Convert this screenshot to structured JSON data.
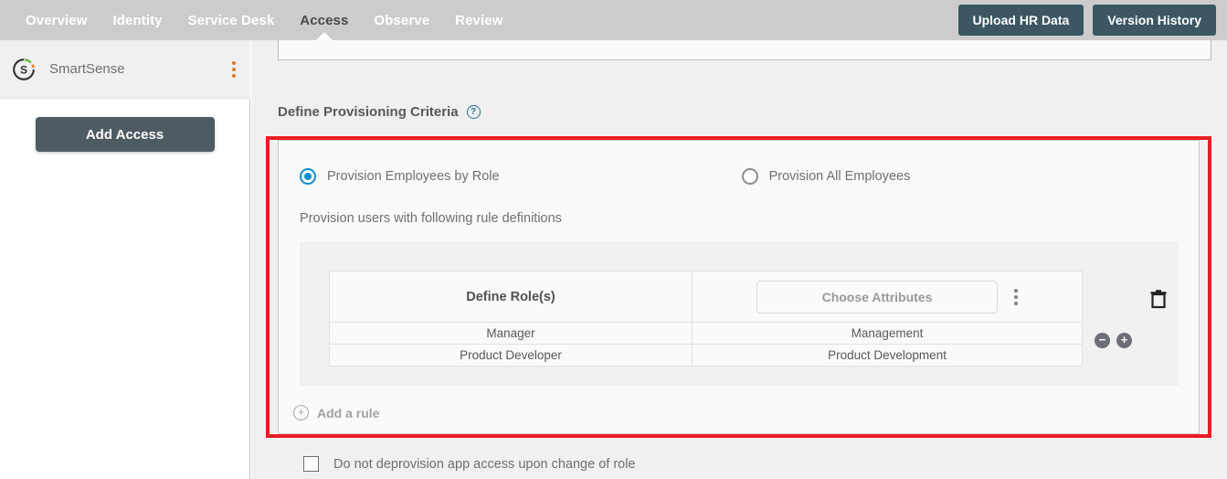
{
  "topnav": {
    "items": [
      {
        "label": "Overview",
        "active": false
      },
      {
        "label": "Identity",
        "active": false
      },
      {
        "label": "Service Desk",
        "active": false
      },
      {
        "label": "Access",
        "active": true
      },
      {
        "label": "Observe",
        "active": false
      },
      {
        "label": "Review",
        "active": false
      }
    ],
    "upload_button": "Upload HR Data",
    "version_button": "Version History",
    "bg_color": "#cccccc",
    "button_color": "#3c5763"
  },
  "sidebar": {
    "app_name": "SmartSense",
    "app_logo_letter": "S",
    "kebab_icon": "more-vertical-icon",
    "add_access_button": "Add Access"
  },
  "main": {
    "section_title": "Define Provisioning Criteria",
    "help_icon": "help-circle-icon",
    "highlight_color": "#ed1c24",
    "radios": [
      {
        "label": "Provision Employees by Role",
        "selected": true
      },
      {
        "label": "Provision All Employees",
        "selected": false
      }
    ],
    "rule_subtitle": "Provision users with following rule definitions",
    "table": {
      "headers": [
        "Define Role(s)",
        "Choose Attributes"
      ],
      "attributes_placeholder": "Choose Attributes",
      "kebab_icon": "more-vertical-icon",
      "delete_icon": "trash-icon",
      "remove_row_icon": "minus-circle-icon",
      "add_row_icon": "plus-circle-icon",
      "rows": [
        {
          "role": "Manager",
          "attribute": "Management"
        },
        {
          "role": "Product Developer",
          "attribute": "Product Development"
        }
      ]
    },
    "add_rule": {
      "label": "Add a rule",
      "icon": "plus-circle-outline-icon"
    },
    "deprovision": {
      "label": "Do not deprovision app access upon change of role",
      "checked": false
    }
  }
}
